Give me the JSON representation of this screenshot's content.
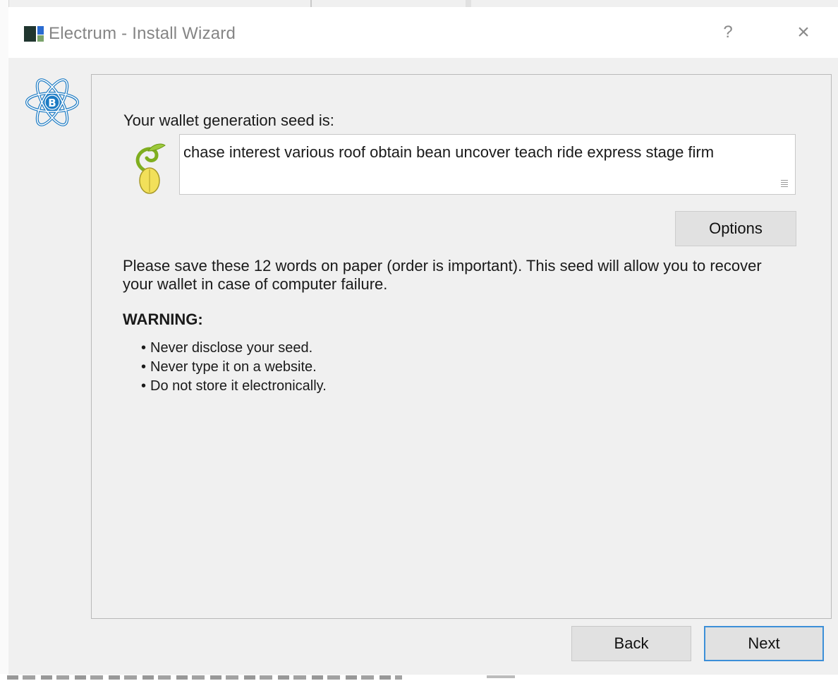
{
  "window": {
    "title": "Electrum  -  Install Wizard",
    "help_label": "?",
    "close_label": "×"
  },
  "wizard": {
    "seed_label": "Your wallet generation seed is:",
    "seed_words": "chase interest various roof obtain bean uncover teach ride express stage firm",
    "options_label": "Options",
    "save_message": "Please save these 12 words on paper (order is important). This seed will allow you to recover your wallet in case of computer failure.",
    "warning_title": "WARNING:",
    "warnings": [
      "Never disclose your seed.",
      "Never type it on a website.",
      "Do not store it electronically."
    ]
  },
  "footer": {
    "back_label": "Back",
    "next_label": "Next"
  },
  "colors": {
    "accent_focus": "#3c8fd8",
    "logo_blue": "#1c7bc4",
    "seed_green": "#7fae1f",
    "seed_yellow": "#f2e05a"
  },
  "icons": {
    "app": "electrum-app-icon",
    "logo": "electrum-bitcoin-logo",
    "seed": "seed-sprout-icon"
  }
}
